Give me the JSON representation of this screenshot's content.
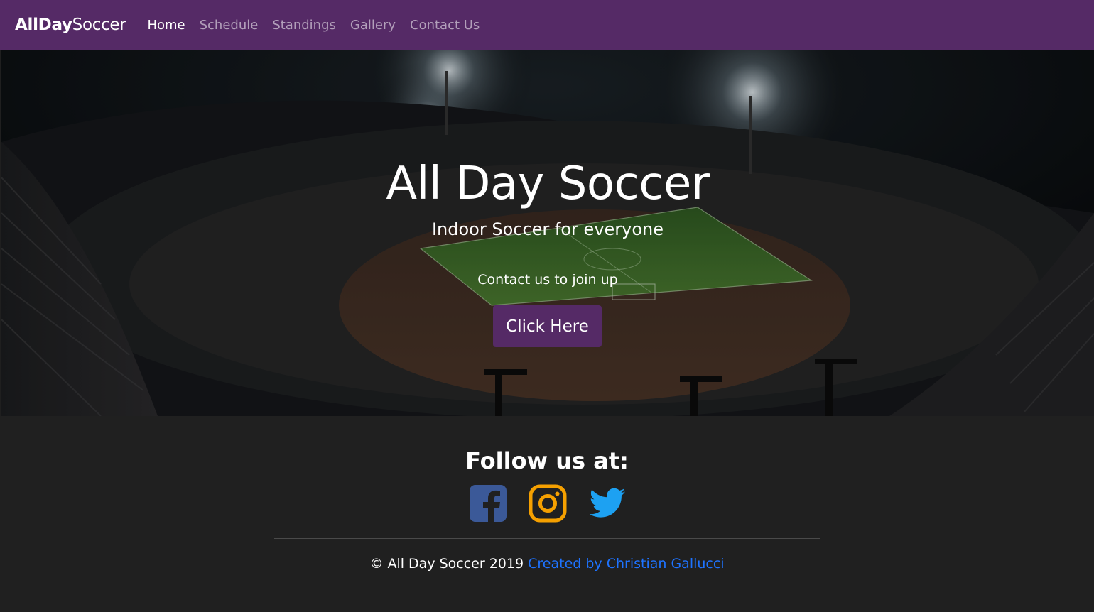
{
  "navbar": {
    "brand_bold": "AllDay",
    "brand_light": "Soccer",
    "links": [
      {
        "label": "Home",
        "active": true
      },
      {
        "label": "Schedule",
        "active": false
      },
      {
        "label": "Standings",
        "active": false
      },
      {
        "label": "Gallery",
        "active": false
      },
      {
        "label": "Contact Us",
        "active": false
      }
    ],
    "bg_color": "#552a66"
  },
  "hero": {
    "title": "All Day Soccer",
    "subtitle": "Indoor Soccer for everyone",
    "cta_text": "Contact us to join up",
    "button_label": "Click Here"
  },
  "footer": {
    "follow_title": "Follow us at:",
    "social": [
      {
        "icon": "facebook-icon",
        "color": "#3b5998"
      },
      {
        "icon": "instagram-icon",
        "color": "#f5a000"
      },
      {
        "icon": "twitter-icon",
        "color": "#1da1f2"
      }
    ],
    "copyright": "© All Day Soccer 2019",
    "credit_link": "Created by Christian Gallucci",
    "link_color": "#1e73ff"
  }
}
